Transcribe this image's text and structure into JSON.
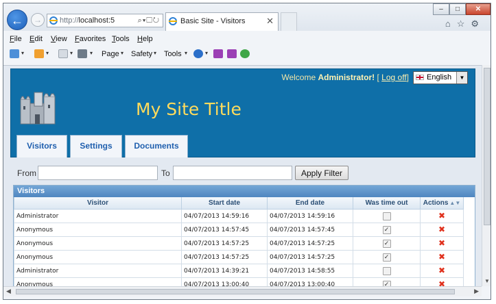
{
  "browser": {
    "address_prefix": "http://",
    "address_host": "localhost:5",
    "tab_title": "Basic Site - Visitors",
    "menu": [
      "File",
      "Edit",
      "View",
      "Favorites",
      "Tools",
      "Help"
    ],
    "commands": {
      "page": "Page",
      "safety": "Safety",
      "tools": "Tools"
    }
  },
  "header": {
    "welcome_prefix": "Welcome",
    "user": "Administrator!",
    "logoff": "Log off",
    "language": "English",
    "title": "My Site Title"
  },
  "nav": [
    {
      "label": "Visitors"
    },
    {
      "label": "Settings"
    },
    {
      "label": "Documents"
    }
  ],
  "filter": {
    "from_label": "From",
    "to_label": "To",
    "from_value": "",
    "to_value": "",
    "apply_label": "Apply Filter"
  },
  "grid": {
    "caption": "Visitors",
    "columns": [
      "Visitor",
      "Start date",
      "End date",
      "Was time out",
      "Actions"
    ],
    "rows": [
      {
        "visitor": "Administrator",
        "start": "04/07/2013 14:59:16",
        "end": "04/07/2013 14:59:16",
        "timed_out": false
      },
      {
        "visitor": "Anonymous",
        "start": "04/07/2013 14:57:45",
        "end": "04/07/2013 14:57:45",
        "timed_out": true
      },
      {
        "visitor": "Anonymous",
        "start": "04/07/2013 14:57:25",
        "end": "04/07/2013 14:57:25",
        "timed_out": true
      },
      {
        "visitor": "Anonymous",
        "start": "04/07/2013 14:57:25",
        "end": "04/07/2013 14:57:25",
        "timed_out": true
      },
      {
        "visitor": "Administrator",
        "start": "04/07/2013 14:39:21",
        "end": "04/07/2013 14:58:55",
        "timed_out": false
      },
      {
        "visitor": "Anonymous",
        "start": "04/07/2013 13:00:40",
        "end": "04/07/2013 13:00:40",
        "timed_out": true
      }
    ]
  },
  "icons": {
    "back": "back-arrow-icon",
    "forward": "forward-arrow-icon",
    "delete": "red-x-icon"
  },
  "colors": {
    "header_bg": "#0f6fa8",
    "title": "#ffdb5c",
    "tab_text": "#1f5fae",
    "delete": "#e0321e"
  }
}
